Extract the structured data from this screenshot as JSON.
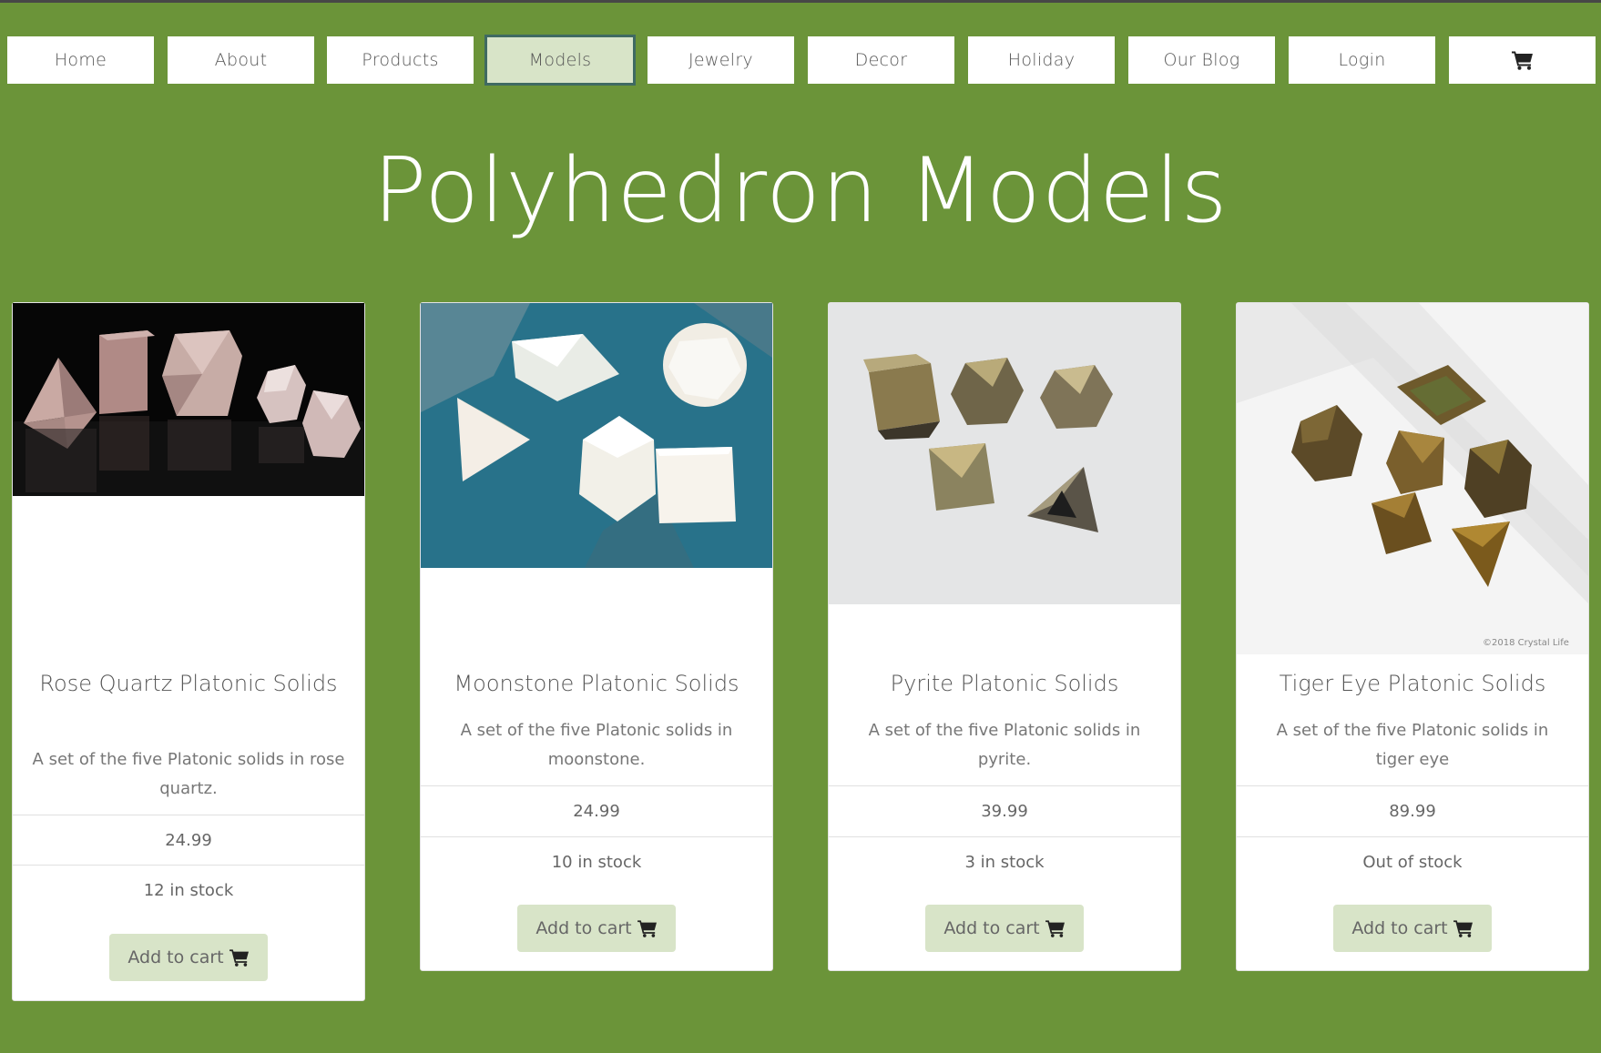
{
  "nav": {
    "items": [
      {
        "label": "Home"
      },
      {
        "label": "About"
      },
      {
        "label": "Products"
      },
      {
        "label": "Models"
      },
      {
        "label": "Jewelry"
      },
      {
        "label": "Decor"
      },
      {
        "label": "Holiday"
      },
      {
        "label": "Our Blog"
      },
      {
        "label": "Login"
      }
    ],
    "active": "Models",
    "cart_icon": "cart-icon"
  },
  "page": {
    "title": "Polyhedron Models"
  },
  "products": [
    {
      "name": "Rose Quartz Platonic Solids",
      "description": "A set of the five Platonic solids in rose quartz.",
      "price": "24.99",
      "stock": "12 in stock",
      "button": "Add to cart"
    },
    {
      "name": "Moonstone Platonic Solids",
      "description": "A set of the five Platonic solids in moonstone.",
      "price": "24.99",
      "stock": "10 in stock",
      "button": "Add to cart"
    },
    {
      "name": "Pyrite Platonic Solids",
      "description": "A set of the five Platonic solids in pyrite.",
      "price": "39.99",
      "stock": "3 in stock",
      "button": "Add to cart"
    },
    {
      "name": "Tiger Eye Platonic Solids",
      "description": "A set of the five Platonic solids in tiger eye",
      "price": "89.99",
      "stock": "Out of stock",
      "button": "Add to cart",
      "watermark": "©2018 Crystal Life"
    }
  ],
  "colors": {
    "background": "#6b9439",
    "nav_active": "#d8e4c8",
    "button": "#d8e4c8"
  }
}
